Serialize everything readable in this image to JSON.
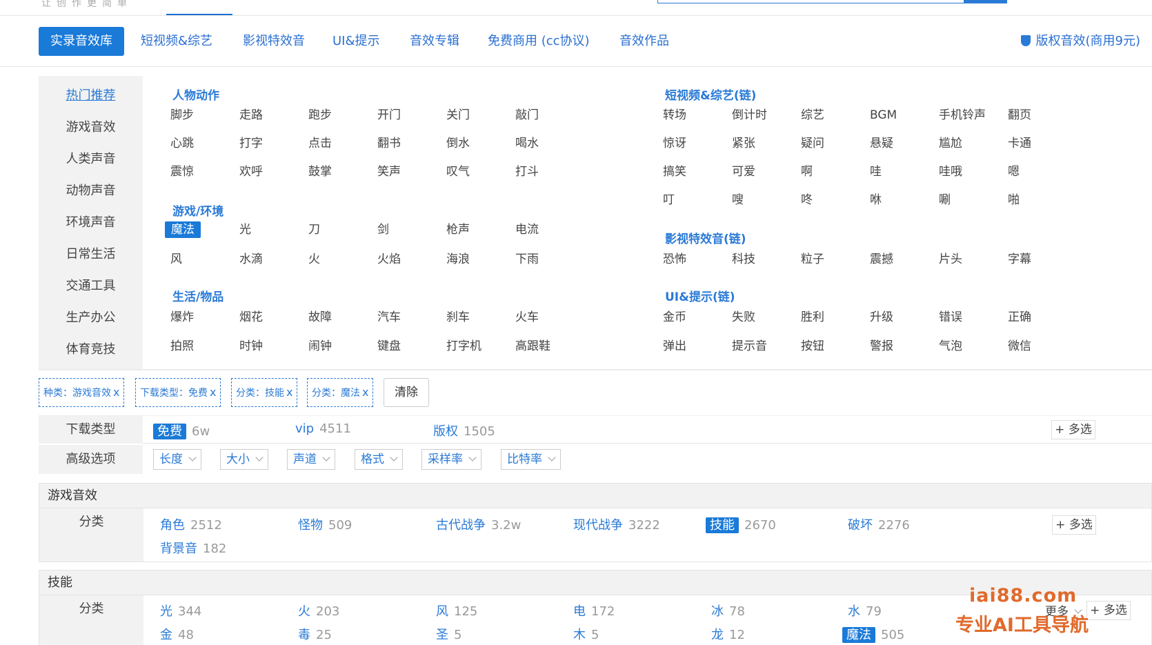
{
  "header": {
    "slogan": "让创作更简单"
  },
  "main_nav": {
    "items": [
      {
        "label": "实录音效库",
        "active": true
      },
      {
        "label": "短视频&综艺"
      },
      {
        "label": "影视特效音"
      },
      {
        "label": "UI&提示"
      },
      {
        "label": "音效专辑"
      },
      {
        "label": "免费商用 (cc协议)"
      },
      {
        "label": "音效作品"
      }
    ],
    "copyright_link": "版权音效(商用9元)"
  },
  "sidebar": {
    "items": [
      "热门推荐",
      "游戏音效",
      "人类声音",
      "动物声音",
      "环境声音",
      "日常生活",
      "交通工具",
      "生产办公",
      "体育竞技"
    ]
  },
  "hot_groups": {
    "people_action": {
      "title": "人物动作",
      "rows": [
        [
          "脚步",
          "走路",
          "跑步",
          "开门",
          "关门",
          "敲门"
        ],
        [
          "心跳",
          "打字",
          "点击",
          "翻书",
          "倒水",
          "喝水"
        ],
        [
          "震惊",
          "欢呼",
          "鼓掌",
          "笑声",
          "叹气",
          "打斗"
        ]
      ]
    },
    "game_env": {
      "title": "游戏/环境",
      "rows": [
        [
          "魔法",
          "光",
          "刀",
          "剑",
          "枪声",
          "电流"
        ],
        [
          "风",
          "水滴",
          "火",
          "火焰",
          "海浪",
          "下雨"
        ]
      ],
      "active": "魔法"
    },
    "life_items": {
      "title": "生活/物品",
      "rows": [
        [
          "爆炸",
          "烟花",
          "故障",
          "汽车",
          "刹车",
          "火车"
        ],
        [
          "拍照",
          "时钟",
          "闹钟",
          "键盘",
          "打字机",
          "高跟鞋"
        ]
      ]
    },
    "short_video": {
      "title": "短视频&综艺(链)",
      "rows": [
        [
          "转场",
          "倒计时",
          "综艺",
          "BGM",
          "手机铃声",
          "翻页"
        ],
        [
          "惊讶",
          "紧张",
          "疑问",
          "悬疑",
          "尴尬",
          "卡通"
        ],
        [
          "搞笑",
          "可爱",
          "啊",
          "哇",
          "哇哦",
          "嗯"
        ],
        [
          "叮",
          "嗖",
          "咚",
          "咻",
          "唰",
          "啪"
        ]
      ]
    },
    "film_fx": {
      "title": "影视特效音(链)",
      "rows": [
        [
          "恐怖",
          "科技",
          "粒子",
          "震撼",
          "片头",
          "字幕"
        ]
      ]
    },
    "ui_tips": {
      "title": "UI&提示(链)",
      "rows": [
        [
          "金币",
          "失败",
          "胜利",
          "升级",
          "错误",
          "正确"
        ],
        [
          "弹出",
          "提示音",
          "按钮",
          "警报",
          "气泡",
          "微信"
        ]
      ]
    }
  },
  "filter_chips": [
    "种类：游戏音效",
    "下载类型：免费",
    "分类：技能",
    "分类：魔法"
  ],
  "chip_close": "x",
  "clear_label": "清除",
  "download_type": {
    "label": "下载类型",
    "options": [
      {
        "name": "免费",
        "count": "6w",
        "active": true
      },
      {
        "name": "vip",
        "count": "4511"
      },
      {
        "name": "版权",
        "count": "1505"
      }
    ],
    "multi_label": "多选"
  },
  "advanced": {
    "label": "高级选项",
    "dropdowns": [
      "长度",
      "大小",
      "声道",
      "格式",
      "采样率",
      "比特率"
    ]
  },
  "game_section": {
    "title": "游戏音效",
    "label": "分类",
    "items": [
      {
        "name": "角色",
        "count": "2512"
      },
      {
        "name": "怪物",
        "count": "509"
      },
      {
        "name": "古代战争",
        "count": "3.2w"
      },
      {
        "name": "现代战争",
        "count": "3222"
      },
      {
        "name": "技能",
        "count": "2670",
        "active": true
      },
      {
        "name": "破坏",
        "count": "2276"
      },
      {
        "name": "背景音",
        "count": "182"
      }
    ],
    "multi_label": "多选"
  },
  "skill_section": {
    "title": "技能",
    "label": "分类",
    "items": [
      {
        "name": "光",
        "count": "344"
      },
      {
        "name": "火",
        "count": "203"
      },
      {
        "name": "风",
        "count": "125"
      },
      {
        "name": "电",
        "count": "172"
      },
      {
        "name": "冰",
        "count": "78"
      },
      {
        "name": "水",
        "count": "79"
      },
      {
        "name": "金",
        "count": "48"
      },
      {
        "name": "毒",
        "count": "25"
      },
      {
        "name": "圣",
        "count": "5"
      },
      {
        "name": "木",
        "count": "5"
      },
      {
        "name": "龙",
        "count": "12"
      },
      {
        "name": "魔法",
        "count": "505",
        "active": true
      }
    ],
    "more_label": "更多",
    "multi_label": "多选"
  },
  "watermark": {
    "domain": "iai88.com",
    "name": "专业AI工具导航"
  },
  "colors": {
    "accent": "#1a7ad8",
    "link": "#2a7ad6",
    "watermark": "#e06a2c"
  }
}
